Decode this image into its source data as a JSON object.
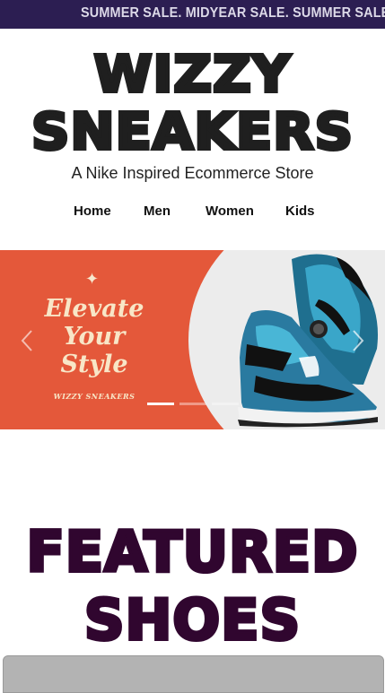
{
  "ticker": {
    "text": "SUMMER SALE. MIDYEAR SALE. SUMMER SALE. MIDYEAR SALE."
  },
  "logo": {
    "line1": "WIZZY",
    "line2": "SNEAKERS"
  },
  "tagline": "A Nike Inspired Ecommerce Store",
  "nav": {
    "items": [
      "Home",
      "Men",
      "Women",
      "Kids"
    ]
  },
  "hero": {
    "title_lines": [
      "Elevate",
      "Your",
      "Style"
    ],
    "brand": "WIZZY SNEAKERS",
    "slide_count": 3,
    "active_slide": 1,
    "icons": {
      "sparkle": "sparkle-icon",
      "prev": "chevron-left-icon",
      "next": "chevron-right-icon"
    }
  },
  "featured": {
    "line1": "FEATURED",
    "line2": "SHOES"
  },
  "colors": {
    "ticker_bg": "#2c1e52",
    "hero_bg": "#e4583a",
    "hero_text": "#f8e6c7",
    "featured_text": "#30062f",
    "logo_text": "#1f1f1f"
  }
}
